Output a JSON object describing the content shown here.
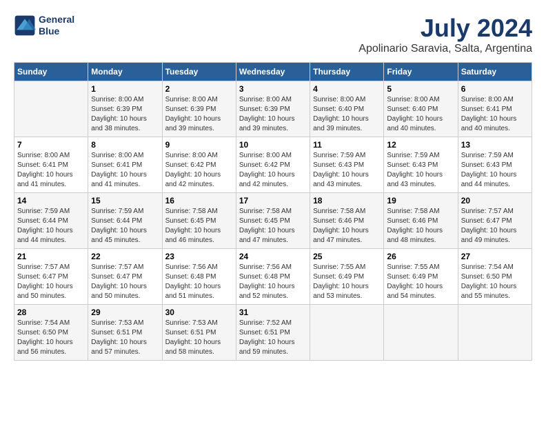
{
  "header": {
    "logo_line1": "General",
    "logo_line2": "Blue",
    "title": "July 2024",
    "subtitle": "Apolinario Saravia, Salta, Argentina"
  },
  "days_of_week": [
    "Sunday",
    "Monday",
    "Tuesday",
    "Wednesday",
    "Thursday",
    "Friday",
    "Saturday"
  ],
  "weeks": [
    [
      {
        "day": "",
        "info": ""
      },
      {
        "day": "1",
        "info": "Sunrise: 8:00 AM\nSunset: 6:39 PM\nDaylight: 10 hours\nand 38 minutes."
      },
      {
        "day": "2",
        "info": "Sunrise: 8:00 AM\nSunset: 6:39 PM\nDaylight: 10 hours\nand 39 minutes."
      },
      {
        "day": "3",
        "info": "Sunrise: 8:00 AM\nSunset: 6:39 PM\nDaylight: 10 hours\nand 39 minutes."
      },
      {
        "day": "4",
        "info": "Sunrise: 8:00 AM\nSunset: 6:40 PM\nDaylight: 10 hours\nand 39 minutes."
      },
      {
        "day": "5",
        "info": "Sunrise: 8:00 AM\nSunset: 6:40 PM\nDaylight: 10 hours\nand 40 minutes."
      },
      {
        "day": "6",
        "info": "Sunrise: 8:00 AM\nSunset: 6:41 PM\nDaylight: 10 hours\nand 40 minutes."
      }
    ],
    [
      {
        "day": "7",
        "info": "Sunrise: 8:00 AM\nSunset: 6:41 PM\nDaylight: 10 hours\nand 41 minutes."
      },
      {
        "day": "8",
        "info": "Sunrise: 8:00 AM\nSunset: 6:41 PM\nDaylight: 10 hours\nand 41 minutes."
      },
      {
        "day": "9",
        "info": "Sunrise: 8:00 AM\nSunset: 6:42 PM\nDaylight: 10 hours\nand 42 minutes."
      },
      {
        "day": "10",
        "info": "Sunrise: 8:00 AM\nSunset: 6:42 PM\nDaylight: 10 hours\nand 42 minutes."
      },
      {
        "day": "11",
        "info": "Sunrise: 7:59 AM\nSunset: 6:43 PM\nDaylight: 10 hours\nand 43 minutes."
      },
      {
        "day": "12",
        "info": "Sunrise: 7:59 AM\nSunset: 6:43 PM\nDaylight: 10 hours\nand 43 minutes."
      },
      {
        "day": "13",
        "info": "Sunrise: 7:59 AM\nSunset: 6:43 PM\nDaylight: 10 hours\nand 44 minutes."
      }
    ],
    [
      {
        "day": "14",
        "info": "Sunrise: 7:59 AM\nSunset: 6:44 PM\nDaylight: 10 hours\nand 44 minutes."
      },
      {
        "day": "15",
        "info": "Sunrise: 7:59 AM\nSunset: 6:44 PM\nDaylight: 10 hours\nand 45 minutes."
      },
      {
        "day": "16",
        "info": "Sunrise: 7:58 AM\nSunset: 6:45 PM\nDaylight: 10 hours\nand 46 minutes."
      },
      {
        "day": "17",
        "info": "Sunrise: 7:58 AM\nSunset: 6:45 PM\nDaylight: 10 hours\nand 47 minutes."
      },
      {
        "day": "18",
        "info": "Sunrise: 7:58 AM\nSunset: 6:46 PM\nDaylight: 10 hours\nand 47 minutes."
      },
      {
        "day": "19",
        "info": "Sunrise: 7:58 AM\nSunset: 6:46 PM\nDaylight: 10 hours\nand 48 minutes."
      },
      {
        "day": "20",
        "info": "Sunrise: 7:57 AM\nSunset: 6:47 PM\nDaylight: 10 hours\nand 49 minutes."
      }
    ],
    [
      {
        "day": "21",
        "info": "Sunrise: 7:57 AM\nSunset: 6:47 PM\nDaylight: 10 hours\nand 50 minutes."
      },
      {
        "day": "22",
        "info": "Sunrise: 7:57 AM\nSunset: 6:47 PM\nDaylight: 10 hours\nand 50 minutes."
      },
      {
        "day": "23",
        "info": "Sunrise: 7:56 AM\nSunset: 6:48 PM\nDaylight: 10 hours\nand 51 minutes."
      },
      {
        "day": "24",
        "info": "Sunrise: 7:56 AM\nSunset: 6:48 PM\nDaylight: 10 hours\nand 52 minutes."
      },
      {
        "day": "25",
        "info": "Sunrise: 7:55 AM\nSunset: 6:49 PM\nDaylight: 10 hours\nand 53 minutes."
      },
      {
        "day": "26",
        "info": "Sunrise: 7:55 AM\nSunset: 6:49 PM\nDaylight: 10 hours\nand 54 minutes."
      },
      {
        "day": "27",
        "info": "Sunrise: 7:54 AM\nSunset: 6:50 PM\nDaylight: 10 hours\nand 55 minutes."
      }
    ],
    [
      {
        "day": "28",
        "info": "Sunrise: 7:54 AM\nSunset: 6:50 PM\nDaylight: 10 hours\nand 56 minutes."
      },
      {
        "day": "29",
        "info": "Sunrise: 7:53 AM\nSunset: 6:51 PM\nDaylight: 10 hours\nand 57 minutes."
      },
      {
        "day": "30",
        "info": "Sunrise: 7:53 AM\nSunset: 6:51 PM\nDaylight: 10 hours\nand 58 minutes."
      },
      {
        "day": "31",
        "info": "Sunrise: 7:52 AM\nSunset: 6:51 PM\nDaylight: 10 hours\nand 59 minutes."
      },
      {
        "day": "",
        "info": ""
      },
      {
        "day": "",
        "info": ""
      },
      {
        "day": "",
        "info": ""
      }
    ]
  ]
}
